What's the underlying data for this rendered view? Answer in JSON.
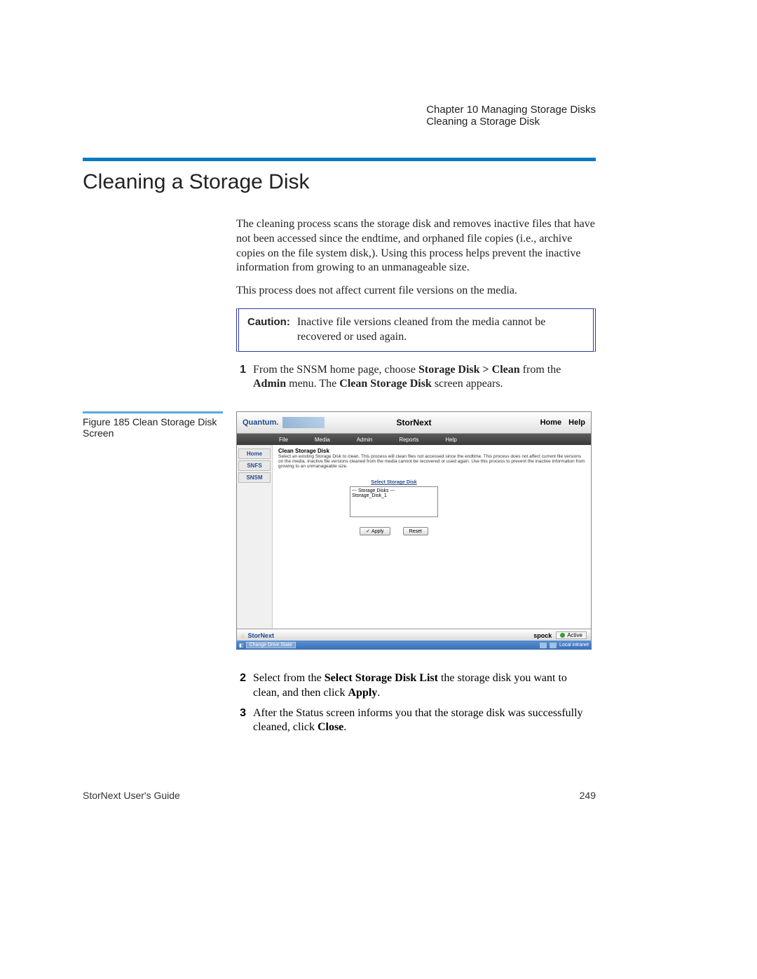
{
  "header": {
    "chapter": "Chapter 10  Managing Storage Disks",
    "section": "Cleaning a Storage Disk"
  },
  "title": "Cleaning a Storage Disk",
  "intro_p1": "The cleaning process scans the storage disk and removes inactive files that have not been accessed since the endtime, and orphaned file copies (i.e., archive copies on the file system disk,). Using this process helps prevent the inactive information from growing to an unmanageable size.",
  "intro_p2": "This process does not affect current file versions on the media.",
  "caution": {
    "label": "Caution:",
    "text": "Inactive file versions cleaned from the media cannot be recovered or used again."
  },
  "step1": {
    "num": "1",
    "pre": "From the SNSM home page, choose ",
    "bold1": "Storage Disk > Clean",
    "mid": " from the ",
    "bold2": "Admin",
    "post": " menu. The ",
    "bold3": "Clean Storage Disk",
    "end": " screen appears."
  },
  "figure_caption": "Figure 185  Clean Storage Disk Screen",
  "screenshot": {
    "brand": "Quantum.",
    "product": "StorNext",
    "home": "Home",
    "help": "Help",
    "menus": [
      "File",
      "Media",
      "Admin",
      "Reports",
      "Help"
    ],
    "sidebar": [
      "Home",
      "SNFS",
      "SNSM"
    ],
    "panel_title": "Clean Storage Disk",
    "panel_desc": "Select an existing Storage Disk to clean.\nThis process will clean files not accessed since the endtime.\nThis process does not affect current file versions on the media. Inactive file versions cleaned from the media cannot be recovered or used again. Use this process to prevent the inactive information from growing to an unmanageable size.",
    "select_label": "Select Storage Disk",
    "select_header": "--- Storage Disks ---",
    "select_item": "Storage_Disk_1",
    "apply": "Apply",
    "reset": "Reset",
    "footer_brand": "StorNext",
    "host": "spock",
    "status": "Active",
    "taskbar_left": "Change Drive State",
    "taskbar_right": "Local intranet"
  },
  "step2": {
    "num": "2",
    "pre": "Select from the ",
    "bold1": "Select Storage Disk List",
    "mid": " the storage disk you want to clean, and then click ",
    "bold2": "Apply",
    "end": "."
  },
  "step3": {
    "num": "3",
    "pre": "After the Status screen informs you that the storage disk was successfully cleaned, click ",
    "bold1": "Close",
    "end": "."
  },
  "footer": {
    "left": "StorNext User's Guide",
    "right": "249"
  }
}
